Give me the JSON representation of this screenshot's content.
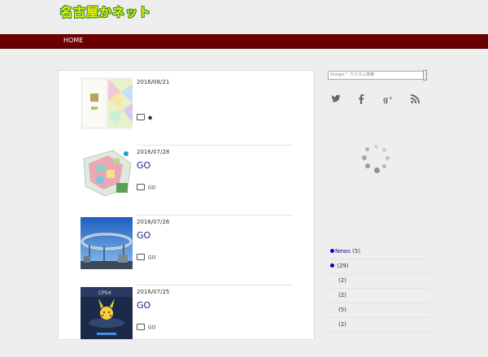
{
  "site": {
    "title": "名古屋かネット"
  },
  "nav": {
    "home_label": "HOME"
  },
  "posts": [
    {
      "date": "2016/08/21",
      "title": "",
      "category": "●"
    },
    {
      "date": "2016/07/28",
      "title": "GO",
      "category": "GO"
    },
    {
      "date": "2016/07/26",
      "title": "GO",
      "category": "GO"
    },
    {
      "date": "2016/07/25",
      "title": "GO",
      "category": "GO"
    }
  ],
  "sidebar": {
    "search_placeholder": "Google™ カスタム検索",
    "social_icons": [
      "twitter-icon",
      "facebook-icon",
      "google-plus-icon",
      "rss-icon"
    ],
    "categories": [
      {
        "name": "News",
        "count": "(5)",
        "bullet": true
      },
      {
        "name": "",
        "count": "(29)",
        "bullet": true
      },
      {
        "name": "",
        "count": "(2)",
        "bullet": false
      },
      {
        "name": "",
        "count": "(2)",
        "bullet": false
      },
      {
        "name": "",
        "count": "(5)",
        "bullet": false
      },
      {
        "name": "",
        "count": "(2)",
        "bullet": false
      }
    ]
  },
  "colors": {
    "navbar": "#6b0000",
    "link": "#1a1a8c",
    "logo_fill": "#f2f200",
    "logo_stroke": "#2e8a2e"
  }
}
